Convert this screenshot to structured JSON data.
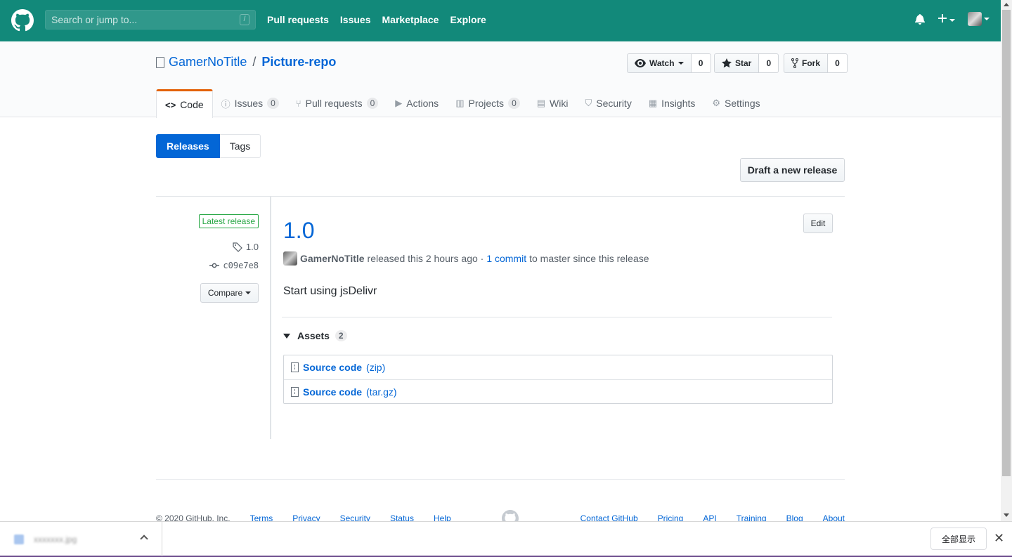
{
  "topnav": {
    "search_placeholder": "Search or jump to...",
    "search_key": "/",
    "links": [
      "Pull requests",
      "Issues",
      "Marketplace",
      "Explore"
    ],
    "bg_color": "#12897a"
  },
  "repo": {
    "owner": "GamerNoTitle",
    "separator": "/",
    "name": "Picture-repo",
    "watch_label": "Watch",
    "watch_count": "0",
    "star_label": "Star",
    "star_count": "0",
    "fork_label": "Fork",
    "fork_count": "0"
  },
  "reponav": {
    "code": "Code",
    "issues": "Issues",
    "issues_count": "0",
    "pulls": "Pull requests",
    "pulls_count": "0",
    "actions": "Actions",
    "projects": "Projects",
    "projects_count": "0",
    "wiki": "Wiki",
    "security": "Security",
    "insights": "Insights",
    "settings": "Settings"
  },
  "subnav": {
    "releases": "Releases",
    "tags": "Tags",
    "draft_button": "Draft a new release"
  },
  "release": {
    "latest_label": "Latest release",
    "tag": "1.0",
    "commit": "c09e7e8",
    "compare_label": "Compare",
    "edit_label": "Edit",
    "title": "1.0",
    "author": "GamerNoTitle",
    "released_text": "released this 2 hours ago ·",
    "commit_link": "1 commit",
    "since_text": "to master since this release",
    "body": "Start using jsDelivr",
    "assets_label": "Assets",
    "assets_count": "2",
    "assets": [
      {
        "name": "Source code",
        "ext": "(zip)"
      },
      {
        "name": "Source code",
        "ext": "(tar.gz)"
      }
    ]
  },
  "footer": {
    "copyright": "© 2020 GitHub, Inc.",
    "left_links": [
      "Terms",
      "Privacy",
      "Security",
      "Status",
      "Help"
    ],
    "right_links": [
      "Contact GitHub",
      "Pricing",
      "API",
      "Training",
      "Blog",
      "About"
    ]
  },
  "download_bar": {
    "file_name": "xxxxxxx.jpg",
    "show_all": "全部显示",
    "close": "✕"
  }
}
